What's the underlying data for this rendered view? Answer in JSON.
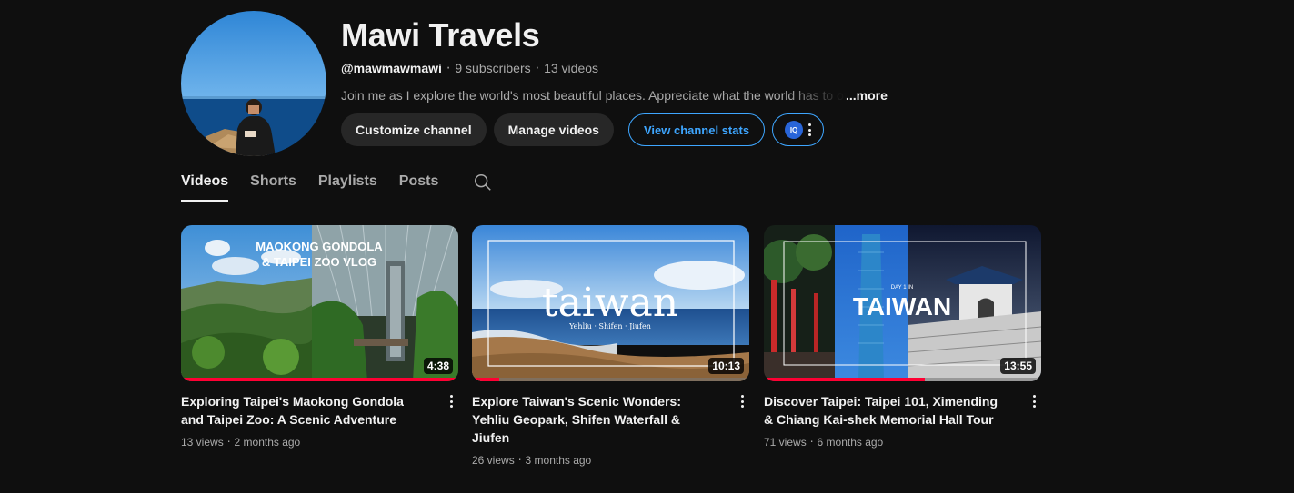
{
  "channel": {
    "name": "Mawi Travels",
    "handle": "@mawmawmawi",
    "subscribers": "9 subscribers",
    "videos_count": "13 videos",
    "meta_separator": "‧",
    "description": "Join me as I explore the world's most beautiful places. Appreciate what the world has to offer",
    "more_label": "...more"
  },
  "actions": {
    "customize": "Customize channel",
    "manage": "Manage videos",
    "stats": "View channel stats",
    "vidiq_label": "IQ"
  },
  "tabs": [
    {
      "label": "Videos",
      "active": true
    },
    {
      "label": "Shorts",
      "active": false
    },
    {
      "label": "Playlists",
      "active": false
    },
    {
      "label": "Posts",
      "active": false
    }
  ],
  "videos": [
    {
      "title": "Exploring Taipei's Maokong Gondola and Taipei Zoo: A Scenic Adventure",
      "views": "13 views",
      "age": "2 months ago",
      "duration": "4:38",
      "progress": 1.0,
      "overlay_text": [
        "MAOKONG GONDOLA",
        "& TAIPEI ZOO VLOG"
      ]
    },
    {
      "title": "Explore Taiwan's Scenic Wonders: Yehliu Geopark, Shifen Waterfall & Jiufen",
      "views": "26 views",
      "age": "3 months ago",
      "duration": "10:13",
      "progress": 0.1,
      "overlay_text": [
        "taiwan",
        "Yehliu · Shifen · Jiufen"
      ]
    },
    {
      "title": "Discover Taipei: Taipei 101, Ximending & Chiang Kai-shek Memorial Hall Tour",
      "views": "71 views",
      "age": "6 months ago",
      "duration": "13:55",
      "progress": 0.58,
      "overlay_text": [
        "DAY 1 IN",
        "TAIWAN"
      ]
    }
  ],
  "colors": {
    "background": "#0f0f0f",
    "accent_blue": "#3ea6ff",
    "progress_red": "#ff0033",
    "button_gray": "#272727"
  }
}
